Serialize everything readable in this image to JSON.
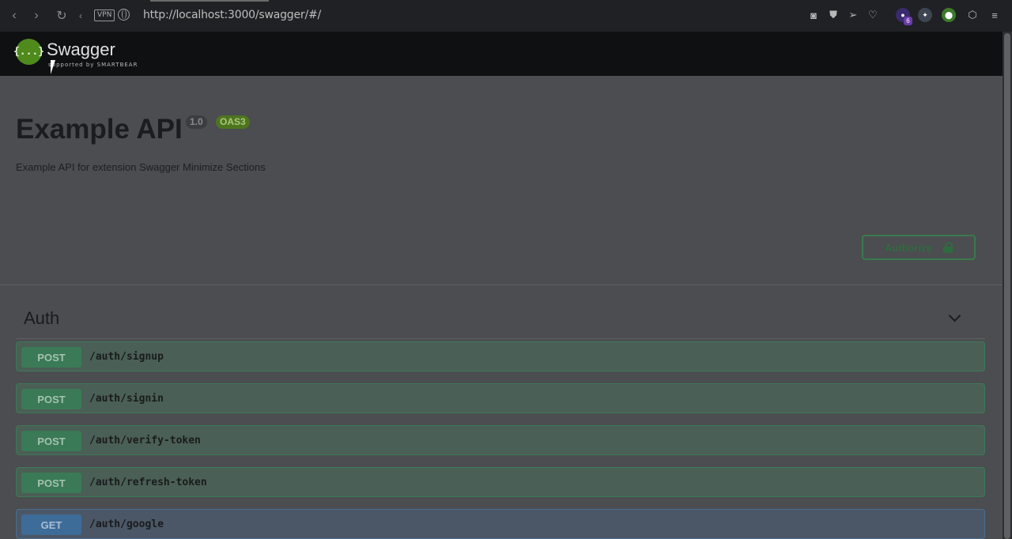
{
  "browser": {
    "url": "http://localhost:3000/swagger/#/",
    "vpn_label": "VPN",
    "extension_badge": "6"
  },
  "topbar": {
    "logo_glyph": "{...}",
    "logo_text": "Swagger",
    "logo_sub": "supported by SMARTBEAR"
  },
  "info": {
    "title": "Example API",
    "version": "1.0",
    "oas_badge": "OAS3",
    "description": "Example API for extension Swagger Minimize Sections"
  },
  "authorize": {
    "label": "Authorize"
  },
  "sections": [
    {
      "name": "Auth",
      "operations": [
        {
          "method": "POST",
          "path": "/auth/signup"
        },
        {
          "method": "POST",
          "path": "/auth/signin"
        },
        {
          "method": "POST",
          "path": "/auth/verify-token"
        },
        {
          "method": "POST",
          "path": "/auth/refresh-token"
        },
        {
          "method": "GET",
          "path": "/auth/google"
        }
      ]
    }
  ],
  "colors": {
    "post": "#3a7a56",
    "get": "#3e6c99",
    "overlay_bg": "#4b4d50",
    "topbar": "#0f1012"
  }
}
